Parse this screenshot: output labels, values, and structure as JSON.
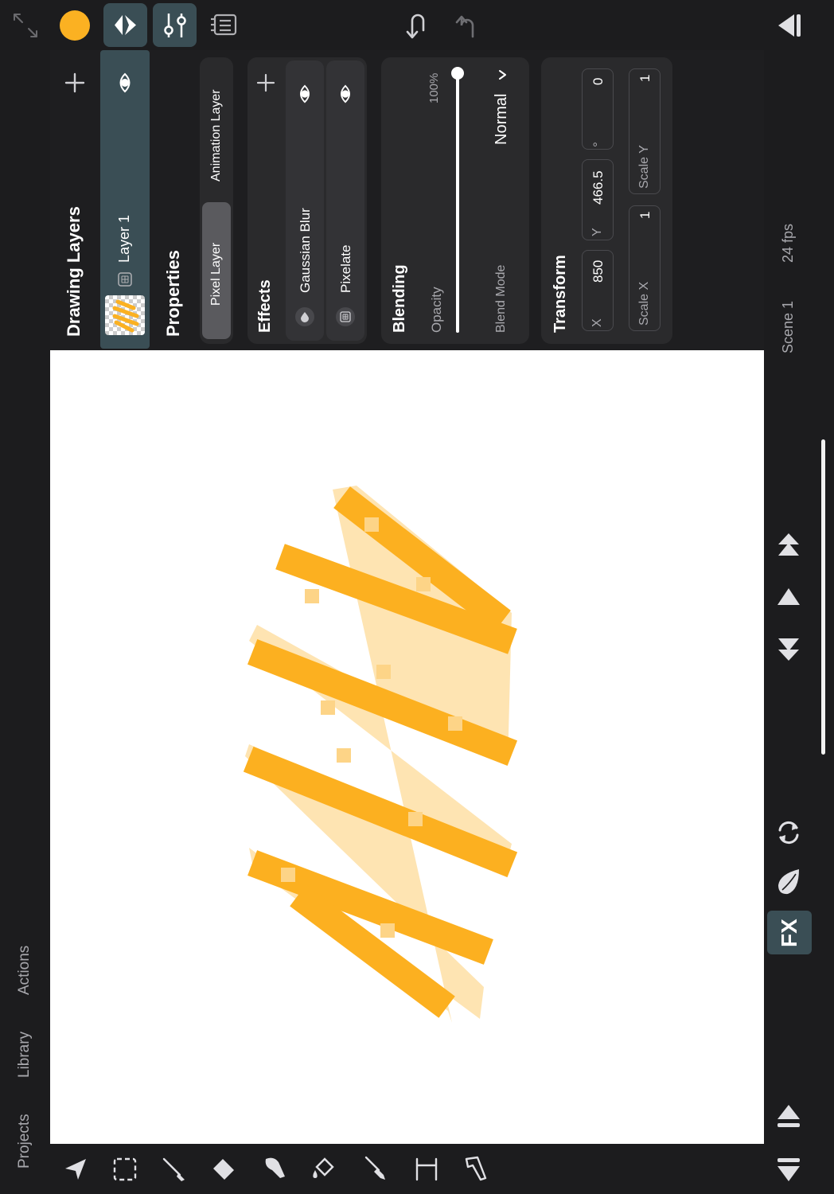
{
  "topbar": {
    "undo_icon": "undo-arrow-icon",
    "redo_icon": "redo-arrow-icon",
    "color_swatch": "#fbb122"
  },
  "layers_panel": {
    "title": "Drawing Layers",
    "layer_name": "Layer 1"
  },
  "properties": {
    "title": "Properties",
    "tab_pixel": "Pixel Layer",
    "tab_animation": "Animation Layer",
    "effects_title": "Effects",
    "effects": [
      {
        "name": "Gaussian Blur"
      },
      {
        "name": "Pixelate"
      }
    ],
    "blending_title": "Blending",
    "opacity_label": "Opacity",
    "opacity_value": "100%",
    "opacity_fraction": 1.0,
    "blend_mode_label": "Blend Mode",
    "blend_mode_value": "Normal",
    "transform_title": "Transform",
    "x_label": "X",
    "x_value": "850",
    "y_label": "Y",
    "y_value": "466.5",
    "rotation_symbol": "°",
    "rotation_value": "0",
    "scale_x_label": "Scale X",
    "scale_x_value": "1",
    "scale_y_label": "Scale Y",
    "scale_y_value": "1"
  },
  "status": {
    "scene": "Scene 1",
    "fps": "24 fps"
  },
  "left_menu": {
    "projects": "Projects",
    "library": "Library",
    "actions": "Actions"
  },
  "fx_button": "FX",
  "colors": {
    "accent": "#fbb122",
    "active_tab": "#3a4e55",
    "background": "#1c1c1e"
  }
}
